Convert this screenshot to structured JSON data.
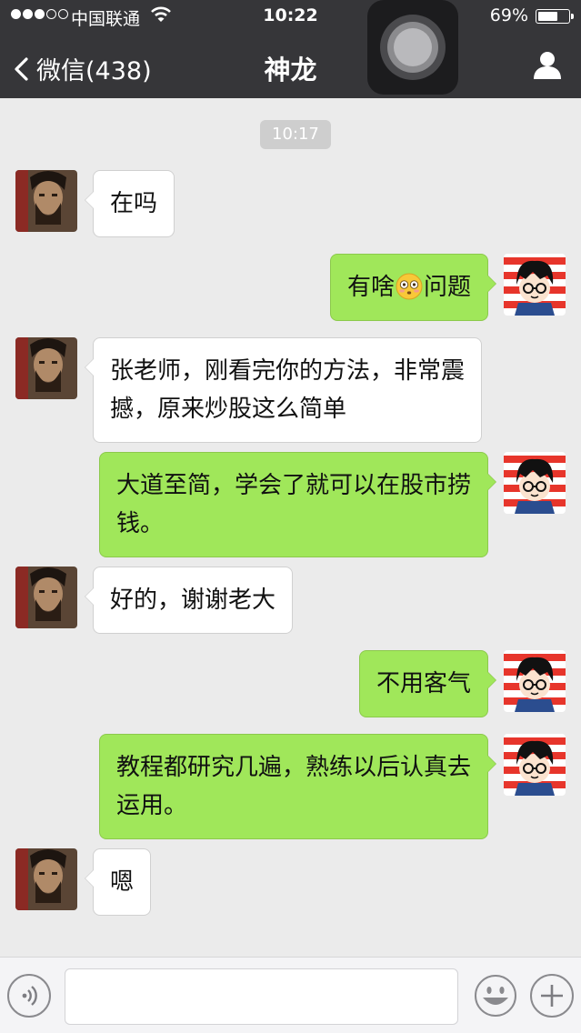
{
  "status_bar": {
    "carrier": "中国联通",
    "time": "10:22",
    "battery_text": "69%",
    "battery_level": 0.69,
    "signal_bars": 3,
    "signal_total": 5
  },
  "nav": {
    "back_label": "微信(438)",
    "title": "神龙"
  },
  "chat": {
    "timestamp": "10:17",
    "messages": [
      {
        "side": "in",
        "text": "在吗"
      },
      {
        "side": "out",
        "text_before": "有啥",
        "emoji": "flushed-face",
        "text_after": "问题"
      },
      {
        "side": "in",
        "line1": "张老师，刚看完你的方法，非常震",
        "line2": "撼，原来炒股这么简单"
      },
      {
        "side": "out",
        "line1": "大道至简，学会了就可以在股市捞",
        "line2": "钱。"
      },
      {
        "side": "in",
        "text": "好的，谢谢老大"
      },
      {
        "side": "out",
        "text": "不用客气"
      },
      {
        "side": "out",
        "line1": "教程都研究几遍，熟练以后认真去",
        "line2": "运用。"
      },
      {
        "side": "in",
        "text": "嗯"
      }
    ]
  },
  "colors": {
    "header_bg": "#363639",
    "chat_bg": "#ebebeb",
    "outgoing_bubble": "#a0e75a",
    "incoming_bubble": "#ffffff"
  }
}
